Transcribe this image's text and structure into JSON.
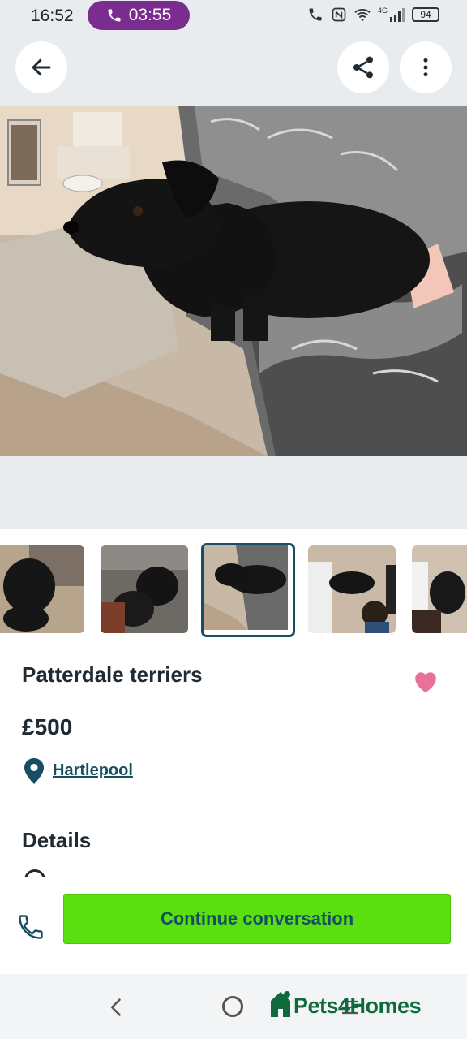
{
  "status_bar": {
    "time": "16:52",
    "call_timer": "03:55",
    "battery": "94",
    "network": "4G"
  },
  "top_bar": {
    "back_icon": "arrow-left-icon",
    "share_icon": "share-icon",
    "menu_icon": "more-vertical-icon"
  },
  "gallery": {
    "thumbnail_count": 5,
    "selected_index": 2
  },
  "listing": {
    "title": "Patterdale terriers",
    "price": "£500",
    "location": "Hartlepool",
    "favorite": true,
    "details_heading": "Details"
  },
  "actions": {
    "continue_label": "Continue conversation",
    "phone_icon": "phone-icon"
  },
  "branding": {
    "logo_text": "Pets4Homes"
  },
  "colors": {
    "accent_green": "#5ae010",
    "brand_teal": "#174e63",
    "heart_pink": "#e9709b",
    "call_purple": "#7a2c8f"
  }
}
